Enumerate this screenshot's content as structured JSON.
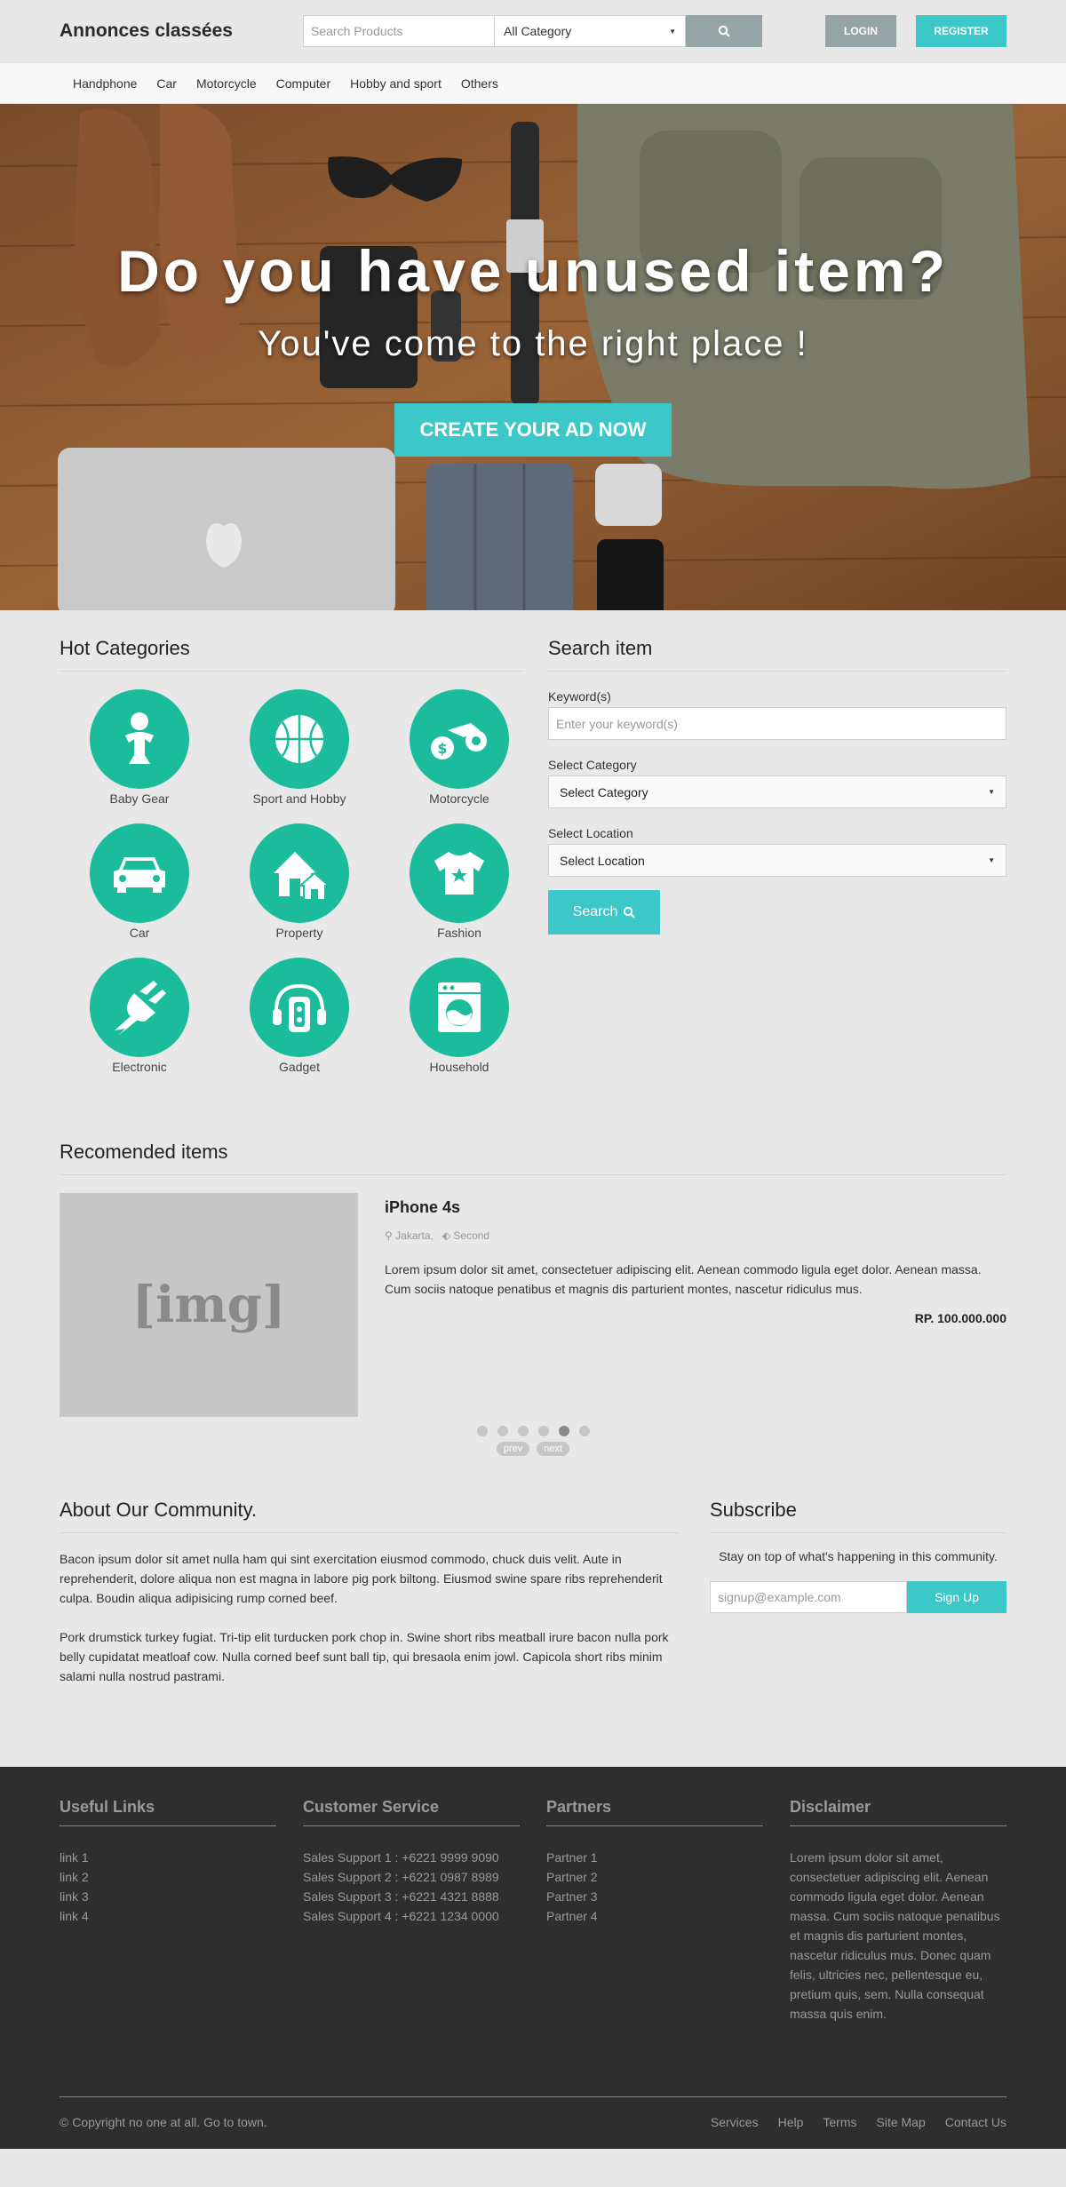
{
  "header": {
    "brand": "Annonces classées",
    "search_placeholder": "Search Products",
    "category_value": "All Category",
    "login_label": "LOGIN",
    "register_label": "REGISTER"
  },
  "catnav": {
    "items": [
      "Handphone",
      "Car",
      "Motorcycle",
      "Computer",
      "Hobby and sport",
      "Others"
    ]
  },
  "hero": {
    "title": "Do you have unused item?",
    "subtitle": "You've come to the right place !",
    "cta": "CREATE YOUR AD NOW"
  },
  "hot_categories": {
    "title": "Hot Categories",
    "items": [
      {
        "label": "Baby Gear",
        "icon": "baby-icon"
      },
      {
        "label": "Sport and Hobby",
        "icon": "basketball-icon"
      },
      {
        "label": "Motorcycle",
        "icon": "motorcycle-icon"
      },
      {
        "label": "Car",
        "icon": "car-icon"
      },
      {
        "label": "Property",
        "icon": "house-icon"
      },
      {
        "label": "Fashion",
        "icon": "tshirt-icon"
      },
      {
        "label": "Electronic",
        "icon": "plug-icon"
      },
      {
        "label": "Gadget",
        "icon": "music-player-icon"
      },
      {
        "label": "Household",
        "icon": "washing-machine-icon"
      }
    ]
  },
  "search_item": {
    "title": "Search item",
    "keyword_label": "Keyword(s)",
    "keyword_placeholder": "Enter your keyword(s)",
    "category_label": "Select Category",
    "category_value": "Select Category",
    "location_label": "Select Location",
    "location_value": "Select Location",
    "button_label": "Search"
  },
  "recommended": {
    "title": "Recomended items",
    "image_placeholder": "[img]",
    "item": {
      "name": "iPhone 4s",
      "location": "Jakarta,",
      "condition": "Second",
      "description": "Lorem ipsum dolor sit amet, consectetuer adipiscing elit. Aenean commodo ligula eget dolor. Aenean massa. Cum sociis natoque penatibus et magnis dis parturient montes, nascetur ridiculus mus.",
      "price": "RP. 100.000.000"
    },
    "slide_count": 6,
    "active_slide": 5,
    "prev_label": "prev",
    "next_label": "next"
  },
  "about": {
    "title": "About Our Community.",
    "p1": "Bacon ipsum dolor sit amet nulla ham qui sint exercitation eiusmod commodo, chuck duis velit. Aute in reprehenderit, dolore aliqua non est magna in labore pig pork biltong. Eiusmod swine spare ribs reprehenderit culpa. Boudin aliqua adipisicing rump corned beef.",
    "p2": "Pork drumstick turkey fugiat. Tri-tip elit turducken pork chop in. Swine short ribs meatball irure bacon nulla pork belly cupidatat meatloaf cow. Nulla corned beef sunt ball tip, qui bresaola enim jowl. Capicola short ribs minim salami nulla nostrud pastrami."
  },
  "subscribe": {
    "title": "Subscribe",
    "text": "Stay on top of what's happening in this community.",
    "placeholder": "signup@example.com",
    "button": "Sign Up"
  },
  "footer": {
    "useful_links": {
      "title": "Useful Links",
      "items": [
        "link 1",
        "link 2",
        "link 3",
        "link 4"
      ]
    },
    "customer_service": {
      "title": "Customer Service",
      "items": [
        "Sales Support 1 : +6221 9999 9090",
        "Sales Support 2 : +6221 0987 8989",
        "Sales Support 3 : +6221 4321 8888",
        "Sales Support 4 : +6221 1234 0000"
      ]
    },
    "partners": {
      "title": "Partners",
      "items": [
        "Partner 1",
        "Partner 2",
        "Partner 3",
        "Partner 4"
      ]
    },
    "disclaimer": {
      "title": "Disclaimer",
      "text": "Lorem ipsum dolor sit amet, consectetuer adipiscing elit. Aenean commodo ligula eget dolor. Aenean massa. Cum sociis natoque penatibus et magnis dis parturient montes, nascetur ridiculus mus. Donec quam felis, ultricies nec, pellentesque eu, pretium quis, sem. Nulla consequat massa quis enim."
    },
    "copyright": "© Copyright no one at all. Go to town.",
    "links": [
      "Services",
      "Help",
      "Terms",
      "Site Map",
      "Contact Us"
    ]
  },
  "colors": {
    "accent": "#3cc8c9",
    "category_green": "#1abc9c",
    "muted_button": "#95a5a6",
    "footer_bg": "#2e2e2e"
  }
}
